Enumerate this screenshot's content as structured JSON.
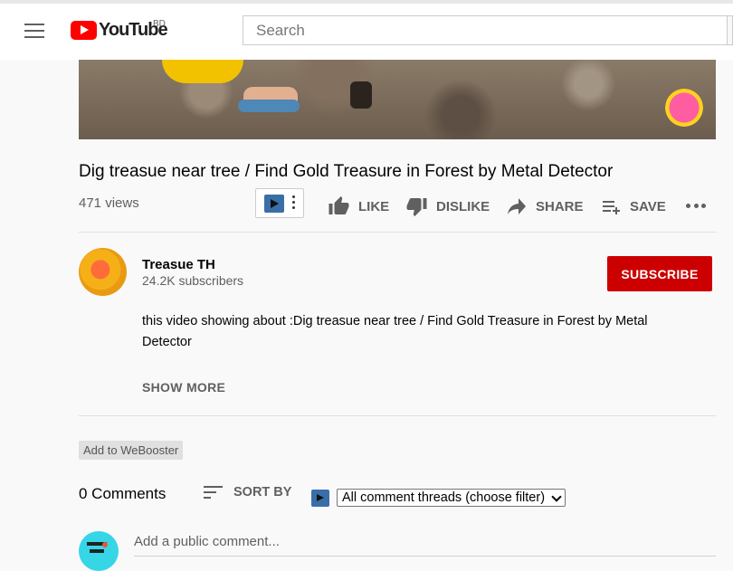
{
  "header": {
    "logo_text": "YouTube",
    "country_code": "BD",
    "search_placeholder": "Search"
  },
  "video": {
    "title": "Dig treasue near tree / Find Gold Treasure in Forest by Metal Detector",
    "views": "471 views",
    "actions": {
      "like": "LIKE",
      "dislike": "DISLIKE",
      "share": "SHARE",
      "save": "SAVE"
    }
  },
  "channel": {
    "name": "Treasue TH",
    "subscribers": "24.2K subscribers",
    "subscribe_label": "SUBSCRIBE"
  },
  "description": {
    "text": "this video showing about :Dig treasue near tree / Find Gold Treasure in Forest by Metal Detector",
    "show_more": "SHOW MORE"
  },
  "extension": {
    "webooster_label": "Add to WeBooster"
  },
  "comments": {
    "count_label": "0 Comments",
    "sort_label": "SORT BY",
    "filter_value": "All comment threads (choose filter)",
    "add_placeholder": "Add a public comment..."
  },
  "colors": {
    "subscribe_bg": "#cc0000",
    "logo_red": "#ff0000",
    "secondary_text": "#606060"
  }
}
